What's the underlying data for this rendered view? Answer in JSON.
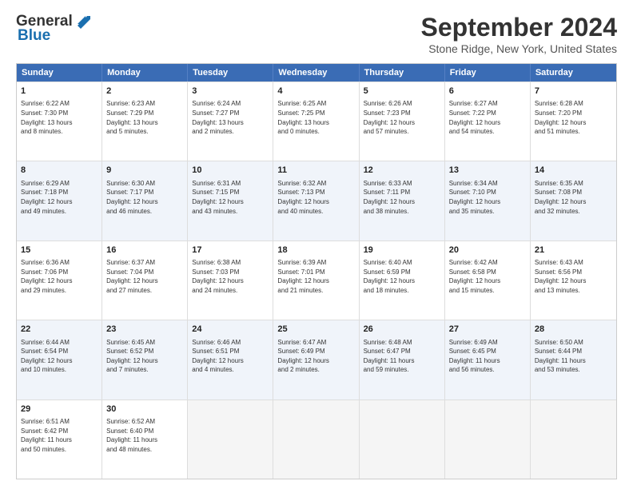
{
  "header": {
    "logo_line1": "General",
    "logo_line2": "Blue",
    "month_title": "September 2024",
    "location": "Stone Ridge, New York, United States"
  },
  "days_of_week": [
    "Sunday",
    "Monday",
    "Tuesday",
    "Wednesday",
    "Thursday",
    "Friday",
    "Saturday"
  ],
  "weeks": [
    [
      {
        "day": "1",
        "lines": [
          "Sunrise: 6:22 AM",
          "Sunset: 7:30 PM",
          "Daylight: 13 hours",
          "and 8 minutes."
        ]
      },
      {
        "day": "2",
        "lines": [
          "Sunrise: 6:23 AM",
          "Sunset: 7:29 PM",
          "Daylight: 13 hours",
          "and 5 minutes."
        ]
      },
      {
        "day": "3",
        "lines": [
          "Sunrise: 6:24 AM",
          "Sunset: 7:27 PM",
          "Daylight: 13 hours",
          "and 2 minutes."
        ]
      },
      {
        "day": "4",
        "lines": [
          "Sunrise: 6:25 AM",
          "Sunset: 7:25 PM",
          "Daylight: 13 hours",
          "and 0 minutes."
        ]
      },
      {
        "day": "5",
        "lines": [
          "Sunrise: 6:26 AM",
          "Sunset: 7:23 PM",
          "Daylight: 12 hours",
          "and 57 minutes."
        ]
      },
      {
        "day": "6",
        "lines": [
          "Sunrise: 6:27 AM",
          "Sunset: 7:22 PM",
          "Daylight: 12 hours",
          "and 54 minutes."
        ]
      },
      {
        "day": "7",
        "lines": [
          "Sunrise: 6:28 AM",
          "Sunset: 7:20 PM",
          "Daylight: 12 hours",
          "and 51 minutes."
        ]
      }
    ],
    [
      {
        "day": "8",
        "lines": [
          "Sunrise: 6:29 AM",
          "Sunset: 7:18 PM",
          "Daylight: 12 hours",
          "and 49 minutes."
        ]
      },
      {
        "day": "9",
        "lines": [
          "Sunrise: 6:30 AM",
          "Sunset: 7:17 PM",
          "Daylight: 12 hours",
          "and 46 minutes."
        ]
      },
      {
        "day": "10",
        "lines": [
          "Sunrise: 6:31 AM",
          "Sunset: 7:15 PM",
          "Daylight: 12 hours",
          "and 43 minutes."
        ]
      },
      {
        "day": "11",
        "lines": [
          "Sunrise: 6:32 AM",
          "Sunset: 7:13 PM",
          "Daylight: 12 hours",
          "and 40 minutes."
        ]
      },
      {
        "day": "12",
        "lines": [
          "Sunrise: 6:33 AM",
          "Sunset: 7:11 PM",
          "Daylight: 12 hours",
          "and 38 minutes."
        ]
      },
      {
        "day": "13",
        "lines": [
          "Sunrise: 6:34 AM",
          "Sunset: 7:10 PM",
          "Daylight: 12 hours",
          "and 35 minutes."
        ]
      },
      {
        "day": "14",
        "lines": [
          "Sunrise: 6:35 AM",
          "Sunset: 7:08 PM",
          "Daylight: 12 hours",
          "and 32 minutes."
        ]
      }
    ],
    [
      {
        "day": "15",
        "lines": [
          "Sunrise: 6:36 AM",
          "Sunset: 7:06 PM",
          "Daylight: 12 hours",
          "and 29 minutes."
        ]
      },
      {
        "day": "16",
        "lines": [
          "Sunrise: 6:37 AM",
          "Sunset: 7:04 PM",
          "Daylight: 12 hours",
          "and 27 minutes."
        ]
      },
      {
        "day": "17",
        "lines": [
          "Sunrise: 6:38 AM",
          "Sunset: 7:03 PM",
          "Daylight: 12 hours",
          "and 24 minutes."
        ]
      },
      {
        "day": "18",
        "lines": [
          "Sunrise: 6:39 AM",
          "Sunset: 7:01 PM",
          "Daylight: 12 hours",
          "and 21 minutes."
        ]
      },
      {
        "day": "19",
        "lines": [
          "Sunrise: 6:40 AM",
          "Sunset: 6:59 PM",
          "Daylight: 12 hours",
          "and 18 minutes."
        ]
      },
      {
        "day": "20",
        "lines": [
          "Sunrise: 6:42 AM",
          "Sunset: 6:58 PM",
          "Daylight: 12 hours",
          "and 15 minutes."
        ]
      },
      {
        "day": "21",
        "lines": [
          "Sunrise: 6:43 AM",
          "Sunset: 6:56 PM",
          "Daylight: 12 hours",
          "and 13 minutes."
        ]
      }
    ],
    [
      {
        "day": "22",
        "lines": [
          "Sunrise: 6:44 AM",
          "Sunset: 6:54 PM",
          "Daylight: 12 hours",
          "and 10 minutes."
        ]
      },
      {
        "day": "23",
        "lines": [
          "Sunrise: 6:45 AM",
          "Sunset: 6:52 PM",
          "Daylight: 12 hours",
          "and 7 minutes."
        ]
      },
      {
        "day": "24",
        "lines": [
          "Sunrise: 6:46 AM",
          "Sunset: 6:51 PM",
          "Daylight: 12 hours",
          "and 4 minutes."
        ]
      },
      {
        "day": "25",
        "lines": [
          "Sunrise: 6:47 AM",
          "Sunset: 6:49 PM",
          "Daylight: 12 hours",
          "and 2 minutes."
        ]
      },
      {
        "day": "26",
        "lines": [
          "Sunrise: 6:48 AM",
          "Sunset: 6:47 PM",
          "Daylight: 11 hours",
          "and 59 minutes."
        ]
      },
      {
        "day": "27",
        "lines": [
          "Sunrise: 6:49 AM",
          "Sunset: 6:45 PM",
          "Daylight: 11 hours",
          "and 56 minutes."
        ]
      },
      {
        "day": "28",
        "lines": [
          "Sunrise: 6:50 AM",
          "Sunset: 6:44 PM",
          "Daylight: 11 hours",
          "and 53 minutes."
        ]
      }
    ],
    [
      {
        "day": "29",
        "lines": [
          "Sunrise: 6:51 AM",
          "Sunset: 6:42 PM",
          "Daylight: 11 hours",
          "and 50 minutes."
        ]
      },
      {
        "day": "30",
        "lines": [
          "Sunrise: 6:52 AM",
          "Sunset: 6:40 PM",
          "Daylight: 11 hours",
          "and 48 minutes."
        ]
      },
      {
        "day": "",
        "lines": []
      },
      {
        "day": "",
        "lines": []
      },
      {
        "day": "",
        "lines": []
      },
      {
        "day": "",
        "lines": []
      },
      {
        "day": "",
        "lines": []
      }
    ]
  ]
}
